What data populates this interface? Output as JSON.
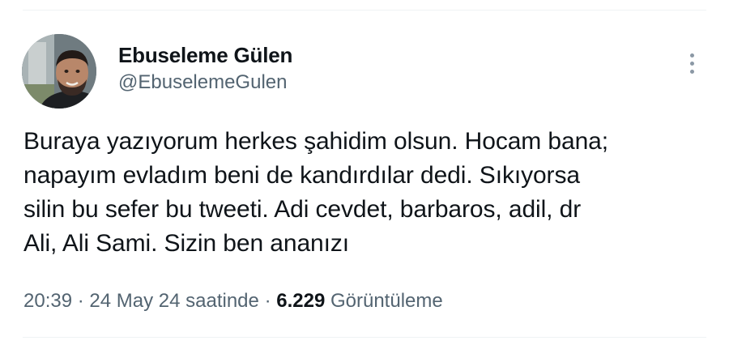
{
  "author": {
    "display_name": "Ebuseleme Gülen",
    "handle": "@EbuselemeGulen"
  },
  "tweet": {
    "text_lines": [
      "Buraya yazıyorum herkes şahidim olsun. Hocam bana;",
      "napayım evladım beni de kandırdılar dedi. Sıkıyorsa",
      "silin bu sefer bu tweeti. Adi cevdet, barbaros, adil, dr",
      "Ali, Ali Sami. Sizin ben ananızı"
    ]
  },
  "meta": {
    "time": "20:39",
    "separator": "·",
    "date": "24 May 24 saatinde",
    "views_count": "6.229",
    "views_label": "Görüntüleme"
  },
  "icons": {
    "more": "more-vertical-icon"
  },
  "colors": {
    "text_primary": "#0f1419",
    "text_secondary": "#536471",
    "divider": "#eff3f4",
    "more_icon": "#8b98a5"
  }
}
